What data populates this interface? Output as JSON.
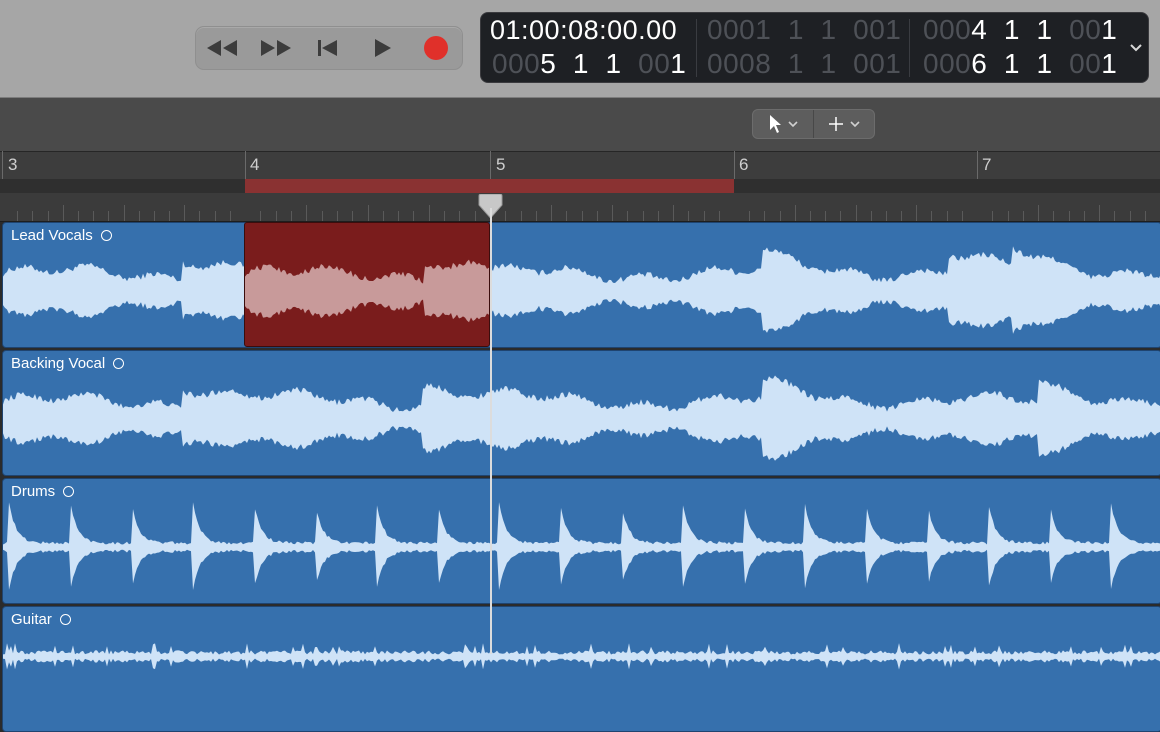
{
  "transport": {
    "buttons": [
      {
        "name": "rewind-button",
        "icon": "rewind-icon"
      },
      {
        "name": "fast-forward-button",
        "icon": "fast-forward-icon"
      },
      {
        "name": "go-to-beginning-button",
        "icon": "go-to-beginning-icon"
      },
      {
        "name": "play-button",
        "icon": "play-icon"
      },
      {
        "name": "record-button",
        "icon": "record-icon"
      }
    ],
    "record_color": "#e0302a"
  },
  "lcd": {
    "time_position": "01:00:08:00.00",
    "bar_position": {
      "dim": "000",
      "bright": "5  1  1",
      "dim2": "00",
      "bright2": "1"
    },
    "cycle_start_top": {
      "dim": "000",
      "main": "1  1  1",
      "dim2": "00",
      "tail": "1"
    },
    "cycle_end_top": {
      "dim": "000",
      "main": "8  1  1",
      "dim2": "00",
      "tail": "1"
    },
    "locator_left": {
      "dim": "000",
      "bright": "4  1  1",
      "dim2": "00",
      "bright2": "1"
    },
    "locator_right": {
      "dim": "000",
      "bright": "6  1  1",
      "dim2": "00",
      "bright2": "1"
    },
    "chevron_icon": "chevron-down-icon"
  },
  "tools": {
    "left_tool": {
      "icon": "pointer-icon",
      "menu_icon": "chevron-down-icon"
    },
    "right_tool": {
      "icon": "marquee-crosshair-icon",
      "menu_icon": "chevron-down-icon"
    }
  },
  "ruler": {
    "bars": [
      "3",
      "4",
      "5",
      "6",
      "7"
    ],
    "cycle_color": "#8a3232"
  },
  "tracks": [
    {
      "name": "Lead Vocals",
      "loop_icon": "loop-icon"
    },
    {
      "name": "Backing Vocal",
      "loop_icon": "loop-icon"
    },
    {
      "name": "Drums",
      "loop_icon": "loop-icon"
    },
    {
      "name": "Guitar",
      "loop_icon": "loop-icon"
    }
  ],
  "colors": {
    "region_blue": "#3670ad",
    "waveform": "#cfe3f7",
    "selection_red": "#7a1c1c",
    "selection_wave": "#c89a9a"
  }
}
